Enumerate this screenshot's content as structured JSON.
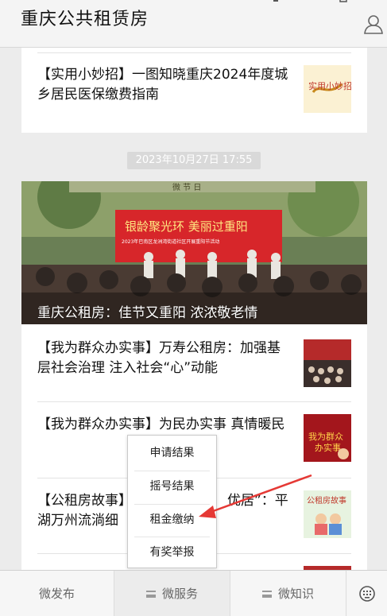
{
  "header": {
    "title": "重庆公共租赁房",
    "user_icon": "user-icon"
  },
  "articles": [
    {
      "title_line1": "【实用小妙招】一图知晓重庆2024年度城",
      "title_line2": "乡居民医保缴费指南",
      "thumb_text": "实用小妙招"
    },
    {
      "timestamp": "2023年10月27日 17:55"
    },
    {
      "hero_caption": "重庆公租房：佳节又重阳 浓浓敬老情",
      "banner_line1": "银龄聚光环  美丽过重阳",
      "banner_line2": "2023年巴南区龙洲湾街道社区开展重阳节活动",
      "banner_top": "微  节  日"
    },
    {
      "title_line1": "【我为群众办实事】万寿公租房：加强基",
      "title_line2": "层社会治理  注入社会“心”动能"
    },
    {
      "title_line1": "【我为群众办实事】为民办实事  真情暖民",
      "thumb_text_1": "我为群众",
      "thumb_text_2": "办实事"
    },
    {
      "title_line1": "【公租房故事】",
      "title_tail_1": "优居”：平",
      "title_line2": "湖万州流淌细",
      "thumb_text": "公租房故事"
    }
  ],
  "popup": {
    "items": [
      "申请结果",
      "摇号结果",
      "租金缴纳",
      "有奖举报"
    ]
  },
  "tabbar": {
    "tabs": [
      "微发布",
      "微服务",
      "微知识"
    ],
    "keyboard_icon": "keyboard-icon"
  },
  "colors": {
    "arrow": "#e53935",
    "banner_red": "#d7262a",
    "tab_selected_bg": "#ececec"
  }
}
